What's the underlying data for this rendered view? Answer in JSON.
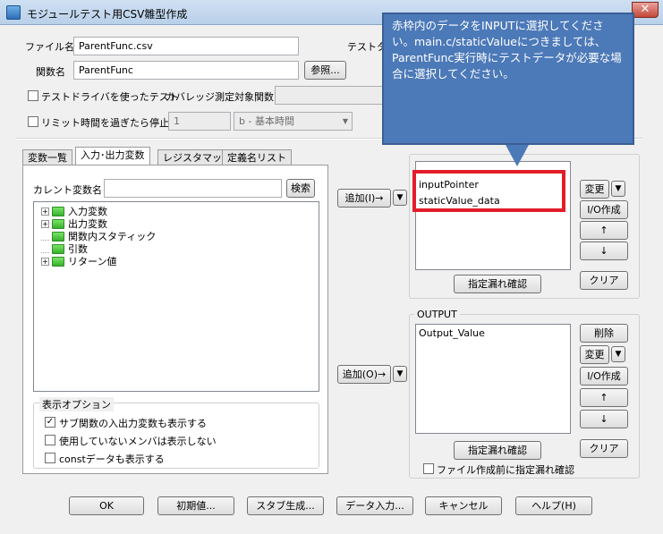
{
  "window": {
    "title": "モジュールテスト用CSV雛型作成",
    "close_glyph": "✕"
  },
  "header": {
    "filename_label": "ファイル名",
    "filename_value": "ParentFunc.csv",
    "testdata_label": "テストター",
    "funcname_label": "関数名",
    "funcname_value": "ParentFunc",
    "browse_button": "参照..."
  },
  "options": {
    "test_driver_label": "テストドライバを使ったテスト",
    "test_driver_checked": false,
    "coverage_label": "カバレッジ測定対象関数",
    "coverage_value": "",
    "time_limit_label": "リミット時間を過ぎたら停止",
    "time_limit_checked": false,
    "time_limit_value": "1",
    "time_unit_value": "b  - 基本時間"
  },
  "tabs": [
    {
      "label": "変数一覧",
      "active": false
    },
    {
      "label": "入力･出力変数",
      "active": true
    },
    {
      "label": "レジスタマップ",
      "active": false
    },
    {
      "label": "定義名リスト",
      "active": false
    }
  ],
  "variables": {
    "current_label": "カレント変数名",
    "current_value": "",
    "search_button": "検索",
    "tree": [
      {
        "label": "入力変数",
        "expandable": true,
        "expand_glyph": "+"
      },
      {
        "label": "出力変数",
        "expandable": true,
        "expand_glyph": "+"
      },
      {
        "label": "関数内スタティック",
        "expandable": false
      },
      {
        "label": "引数",
        "expandable": false
      },
      {
        "label": "リターン値",
        "expandable": true,
        "expand_glyph": "+"
      }
    ]
  },
  "display_options": {
    "title": "表示オプション",
    "items": [
      {
        "label": "サブ関数の入出力変数も表示する",
        "checked": true
      },
      {
        "label": "使用していないメンバは表示しない",
        "checked": false
      },
      {
        "label": "constデータも表示する",
        "checked": false
      }
    ]
  },
  "input_section": {
    "add_button": "追加(I)→",
    "items": [
      "inputPointer",
      "staticValue_data"
    ],
    "change_button": "変更",
    "io_button": "I/O作成",
    "up_button": "↑",
    "down_button": "↓",
    "clear_button": "クリア",
    "check_button": "指定漏れ確認"
  },
  "output_section": {
    "title": "OUTPUT",
    "add_button": "追加(O)→",
    "items": [
      "Output_Value"
    ],
    "delete_button": "削除",
    "change_button": "変更",
    "io_button": "I/O作成",
    "up_button": "↑",
    "down_button": "↓",
    "clear_button": "クリア",
    "check_button": "指定漏れ確認",
    "precheck_label": "ファイル作成前に指定漏れ確認",
    "precheck_checked": false
  },
  "footer": {
    "ok": "OK",
    "defaults": "初期値...",
    "stub": "スタブ生成...",
    "data_input": "データ入力...",
    "cancel": "キャンセル",
    "help": "ヘルプ(H)"
  },
  "glyphs": {
    "dropdown": "▼",
    "check": "✓"
  },
  "callout": {
    "text": "赤枠内のデータをINPUTに選択してください。main.c/staticValueにつきましては、ParentFunc実行時にテストデータが必要な場合に選択してください。",
    "highlight_color": "#e21d2a",
    "bubble_color": "#4c79b8"
  }
}
